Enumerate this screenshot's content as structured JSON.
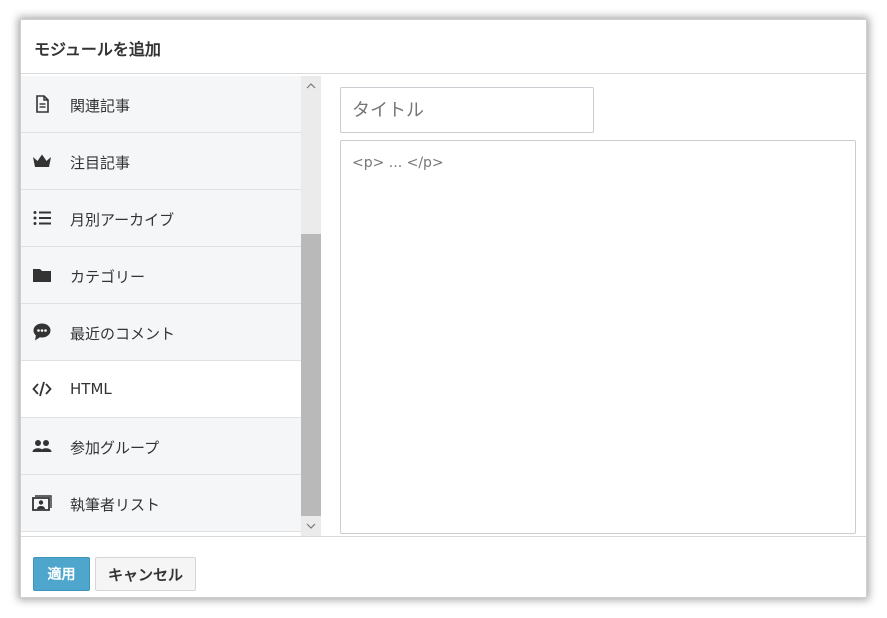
{
  "dialog": {
    "title": "モジュールを追加"
  },
  "modules": [
    {
      "label": "関連記事",
      "icon": "document-icon"
    },
    {
      "label": "注目記事",
      "icon": "crown-icon"
    },
    {
      "label": "月別アーカイブ",
      "icon": "list-icon"
    },
    {
      "label": "カテゴリー",
      "icon": "folder-icon"
    },
    {
      "label": "最近のコメント",
      "icon": "comment-icon"
    },
    {
      "label": "HTML",
      "icon": "code-icon",
      "selected": true
    },
    {
      "label": "参加グループ",
      "icon": "users-icon"
    },
    {
      "label": "執筆者リスト",
      "icon": "author-list-icon"
    }
  ],
  "editor": {
    "title_placeholder": "タイトル",
    "content": "<p> ... </p>"
  },
  "footer": {
    "apply_label": "適用",
    "cancel_label": "キャンセル"
  },
  "colors": {
    "apply_button": "#4fa6cc",
    "list_background": "#f5f6f8",
    "selected_background": "#ffffff"
  }
}
